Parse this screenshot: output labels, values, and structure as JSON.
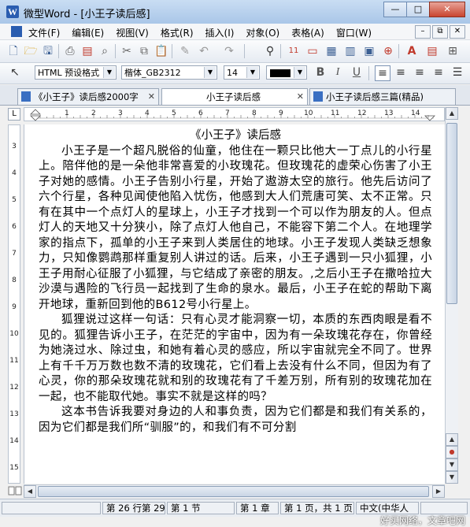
{
  "window": {
    "title": "微型Word - [小王子读后感]"
  },
  "window_buttons": {
    "minimize": "—",
    "maximize": "□",
    "close": "✕"
  },
  "menu": {
    "items": [
      "文件(F)",
      "编辑(E)",
      "视图(V)",
      "格式(R)",
      "插入(I)",
      "对象(O)",
      "表格(A)",
      "窗口(W)"
    ],
    "mdi_buttons": [
      "–",
      "⧉",
      "✕"
    ]
  },
  "formatting": {
    "style": "HTML 预设格式",
    "font": "楷体_GB2312",
    "size": "14",
    "bold": "B",
    "italic": "I",
    "underline": "U",
    "color_value": "#000000"
  },
  "tabs": [
    {
      "label": "《小王子》读后感2000字",
      "active": false
    },
    {
      "label": "小王子读后感",
      "active": true
    },
    {
      "label": "小王子读后感三篇(精品)",
      "active": false
    }
  ],
  "ruler": {
    "corner": "L",
    "h_numbers": [
      "1",
      "2",
      "3",
      "4",
      "5",
      "6",
      "7",
      "8",
      "9",
      "10",
      "11",
      "12",
      "13",
      "14"
    ],
    "v_numbers": [
      "3",
      "4",
      "5",
      "6",
      "7",
      "8",
      "9",
      "10",
      "11",
      "12",
      "13",
      "14",
      "15"
    ]
  },
  "document": {
    "title": "《小王子》读后感",
    "paragraphs": [
      "小王子是一个超凡脱俗的仙童，他住在一颗只比他大一丁点儿的小行星上。陪伴他的是一朵他非常喜爱的小玫瑰花。但玫瑰花的虚荣心伤害了小王子对她的感情。小王子告别小行星，开始了遨游太空的旅行。他先后访问了六个行星，各种见闻使他陷入忧伤，他感到大人们荒唐可笑、太不正常。只有在其中一个点灯人的星球上，小王子才找到一个可以作为朋友的人。但点灯人的天地又十分狭小，除了点灯人他自己，不能容下第二个人。在地理学家的指点下，孤单的小王子来到人类居住的地球。小王子发现人类缺乏想象力，只知像鹦鹉那样重复别人讲过的话。后来，小王子遇到一只小狐狸，小王子用耐心征服了小狐狸，与它结成了亲密的朋友。,之后小王子在撒哈拉大沙漠与遇险的飞行员一起找到了生命的泉水。最后，小王子在蛇的帮助下离开地球，重新回到他的B612号小行星上。",
      "狐狸说过这样一句话：只有心灵才能洞察一切，本质的东西肉眼是看不见的。狐狸告诉小王子，在茫茫的宇宙中，因为有一朵玫瑰花存在，你曾经为她浇过水、除过虫，和她有着心灵的感应，所以宇宙就完全不同了。世界上有千千万万数也数不清的玫瑰花，它们看上去没有什么不同，但因为有了心灵，你的那朵玫瑰花就和别的玫瑰花有了千差万别，所有别的玫瑰花加在一起，也不能取代她。事实不就是这样的吗？",
      "这本书告诉我要对身边的人和事负责，因为它们都是和我们有关系的，因为它们都是我们所“驯服”的，和我们有不可分割"
    ]
  },
  "status": {
    "position": "第 26 行第 29",
    "section": "第 1 节",
    "chapter": "第 1 章",
    "page": "第 1 页，共 1 页",
    "language": "中文(中华人"
  },
  "watermark": "好买网络，文章吧网"
}
